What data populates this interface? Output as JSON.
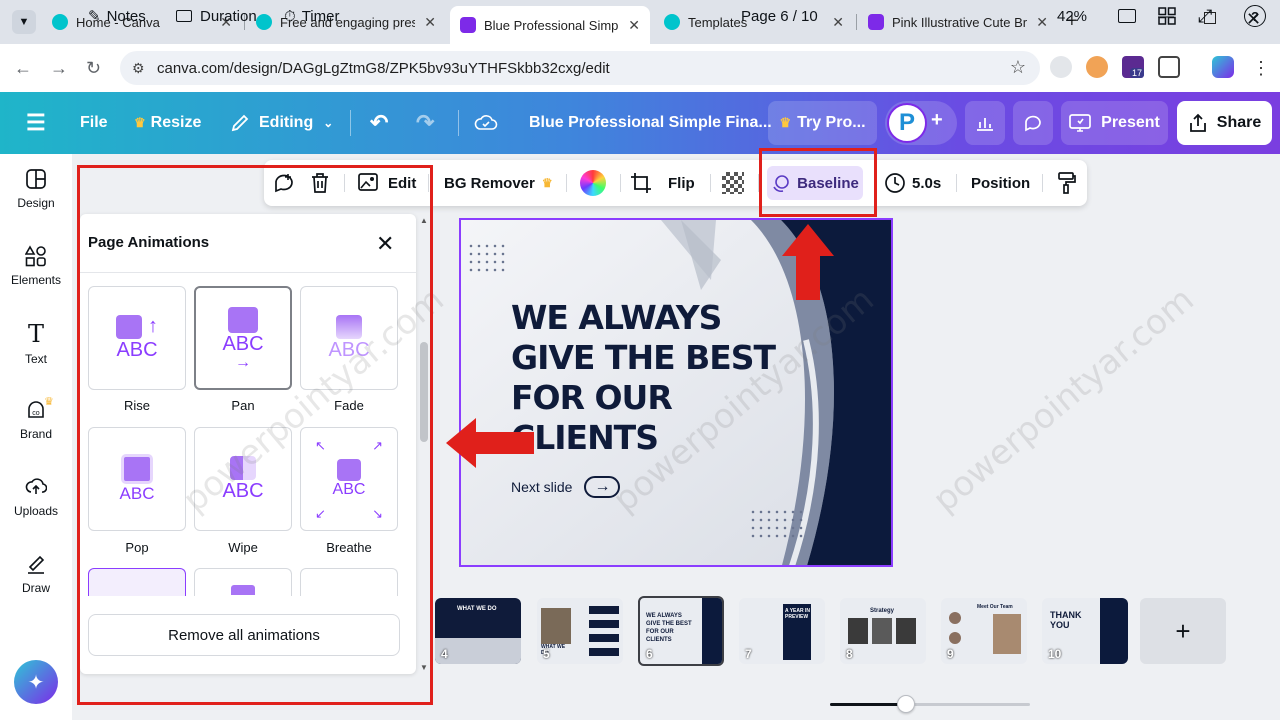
{
  "browser": {
    "tabs": [
      {
        "label": "Home - Canva",
        "active": false
      },
      {
        "label": "Free and engaging prese",
        "active": false
      },
      {
        "label": "Blue Professional Simple",
        "active": true
      },
      {
        "label": "Templates",
        "active": false
      },
      {
        "label": "Pink Illustrative Cute Brai",
        "active": false
      }
    ],
    "url": "canva.com/design/DAGgLgZtmG8/ZPK5bv93uYTHFSkbb32cxg/edit",
    "extension_badge": "17"
  },
  "header": {
    "file": "File",
    "resize": "Resize",
    "editing": "Editing",
    "title": "Blue Professional Simple Fina...",
    "try_pro": "Try Pro...",
    "avatar_letter": "P",
    "present": "Present",
    "share": "Share"
  },
  "rail": [
    {
      "label": "Design",
      "icon": "design-icon"
    },
    {
      "label": "Elements",
      "icon": "elements-icon"
    },
    {
      "label": "Text",
      "icon": "text-icon"
    },
    {
      "label": "Brand",
      "icon": "brand-icon"
    },
    {
      "label": "Uploads",
      "icon": "uploads-icon"
    },
    {
      "label": "Draw",
      "icon": "draw-icon"
    }
  ],
  "toolbar": {
    "edit": "Edit",
    "bg_remover": "BG Remover",
    "flip": "Flip",
    "baseline": "Baseline",
    "duration": "5.0s",
    "position": "Position"
  },
  "panel": {
    "title": "Page Animations",
    "animations": [
      {
        "label": "Rise"
      },
      {
        "label": "Pan"
      },
      {
        "label": "Fade"
      },
      {
        "label": "Pop"
      },
      {
        "label": "Wipe"
      },
      {
        "label": "Breathe"
      }
    ],
    "tile_text": "ABC",
    "remove_all": "Remove all animations"
  },
  "slide": {
    "headline": [
      "WE ALWAYS",
      "GIVE THE BEST",
      "FOR OUR",
      "CLIENTS"
    ],
    "next_slide": "Next slide"
  },
  "thumbnails": [
    {
      "num": "4",
      "text": "WHAT WE DO"
    },
    {
      "num": "5",
      "text": "WHAT WE DO"
    },
    {
      "num": "6",
      "text": "WE ALWAYS GIVE THE BEST FOR OUR CLIENTS"
    },
    {
      "num": "7",
      "text": "A YEAR IN PREVIEW"
    },
    {
      "num": "8",
      "text": "Strategy"
    },
    {
      "num": "9",
      "text": "Meet Our Team"
    },
    {
      "num": "10",
      "text": "THANK YOU"
    }
  ],
  "footer": {
    "notes": "Notes",
    "duration": "Duration",
    "timer": "Timer",
    "page": "Page 6 / 10",
    "zoom": "42%",
    "zoom_level_fraction": 0.38
  },
  "watermark": "powerpointyar.com",
  "colors": {
    "accent": "#8b3dff",
    "annotation_red": "#e0201b",
    "slide_navy": "#0f1b3a"
  }
}
